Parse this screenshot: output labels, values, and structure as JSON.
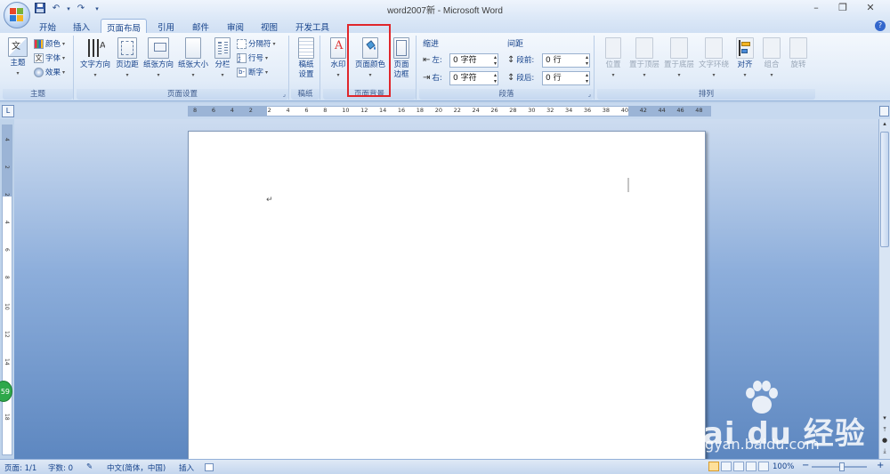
{
  "window": {
    "title": "word2007新 - Microsoft Word",
    "minimize": "–",
    "restore": "❐",
    "close": "✕"
  },
  "qat": {
    "save_icon": "floppy-icon",
    "undo": "↶",
    "undo_caret": "▾",
    "redo": "↷",
    "customize": "▾"
  },
  "tabs": [
    {
      "label": "开始"
    },
    {
      "label": "插入"
    },
    {
      "label": "页面布局",
      "active": true
    },
    {
      "label": "引用"
    },
    {
      "label": "邮件"
    },
    {
      "label": "审阅"
    },
    {
      "label": "视图"
    },
    {
      "label": "开发工具"
    }
  ],
  "help": "?",
  "ribbon": {
    "theme": {
      "label": "主题",
      "main_button": "主题",
      "items": [
        {
          "label": "颜色"
        },
        {
          "label": "字体"
        },
        {
          "label": "效果"
        }
      ]
    },
    "page_setup": {
      "label": "页面设置",
      "buttons": [
        {
          "label": "文字方向"
        },
        {
          "label": "页边距"
        },
        {
          "label": "纸张方向"
        },
        {
          "label": "纸张大小"
        },
        {
          "label": "分栏"
        }
      ],
      "small": [
        {
          "label": "分隔符"
        },
        {
          "label": "行号"
        },
        {
          "label": "断字"
        }
      ]
    },
    "draft": {
      "label": "稿纸",
      "button_line1": "稿纸",
      "button_line2": "设置"
    },
    "page_background": {
      "label": "页面背景",
      "watermark": "水印",
      "page_color": "页面颜色",
      "border_line1": "页面",
      "border_line2": "边框"
    },
    "paragraph": {
      "label": "段落",
      "indent_title": "缩进",
      "spacing_title": "间距",
      "left_label": "左:",
      "left_value": "0 字符",
      "right_label": "右:",
      "right_value": "0 字符",
      "before_label": "段前:",
      "before_value": "0 行",
      "after_label": "段后:",
      "after_value": "0 行"
    },
    "arrange": {
      "label": "排列",
      "buttons": [
        {
          "label": "位置"
        },
        {
          "label": "置于顶层"
        },
        {
          "label": "置于底层"
        },
        {
          "label": "文字环绕"
        },
        {
          "label": "对齐"
        },
        {
          "label": "组合"
        },
        {
          "label": "旋转"
        }
      ]
    }
  },
  "ruler": {
    "h_numbers": [
      "8",
      "6",
      "4",
      "2",
      "2",
      "4",
      "6",
      "8",
      "10",
      "12",
      "14",
      "16",
      "18",
      "20",
      "22",
      "24",
      "26",
      "28",
      "30",
      "32",
      "34",
      "36",
      "38",
      "40",
      "42",
      "44",
      "46",
      "48"
    ],
    "v_numbers": [
      "4",
      "2",
      "2",
      "4",
      "6",
      "8",
      "10",
      "12",
      "14",
      "16",
      "18"
    ]
  },
  "document": {
    "paragraph_mark": "↵"
  },
  "statusbar": {
    "page": "页面: 1/1",
    "words": "字数: 0",
    "language": "中文(简体，中国)",
    "mode": "插入",
    "zoom": "100%",
    "zoom_out": "−",
    "zoom_in": "+"
  },
  "side_badge": "59",
  "watermark": {
    "main": "Bai du 经验",
    "sub": "jingyan.baidu.com"
  },
  "colors": {
    "highlight": "#e0262b",
    "ribbon_text": "#15428b",
    "doc_gradient_dark": "#5d87c0"
  }
}
